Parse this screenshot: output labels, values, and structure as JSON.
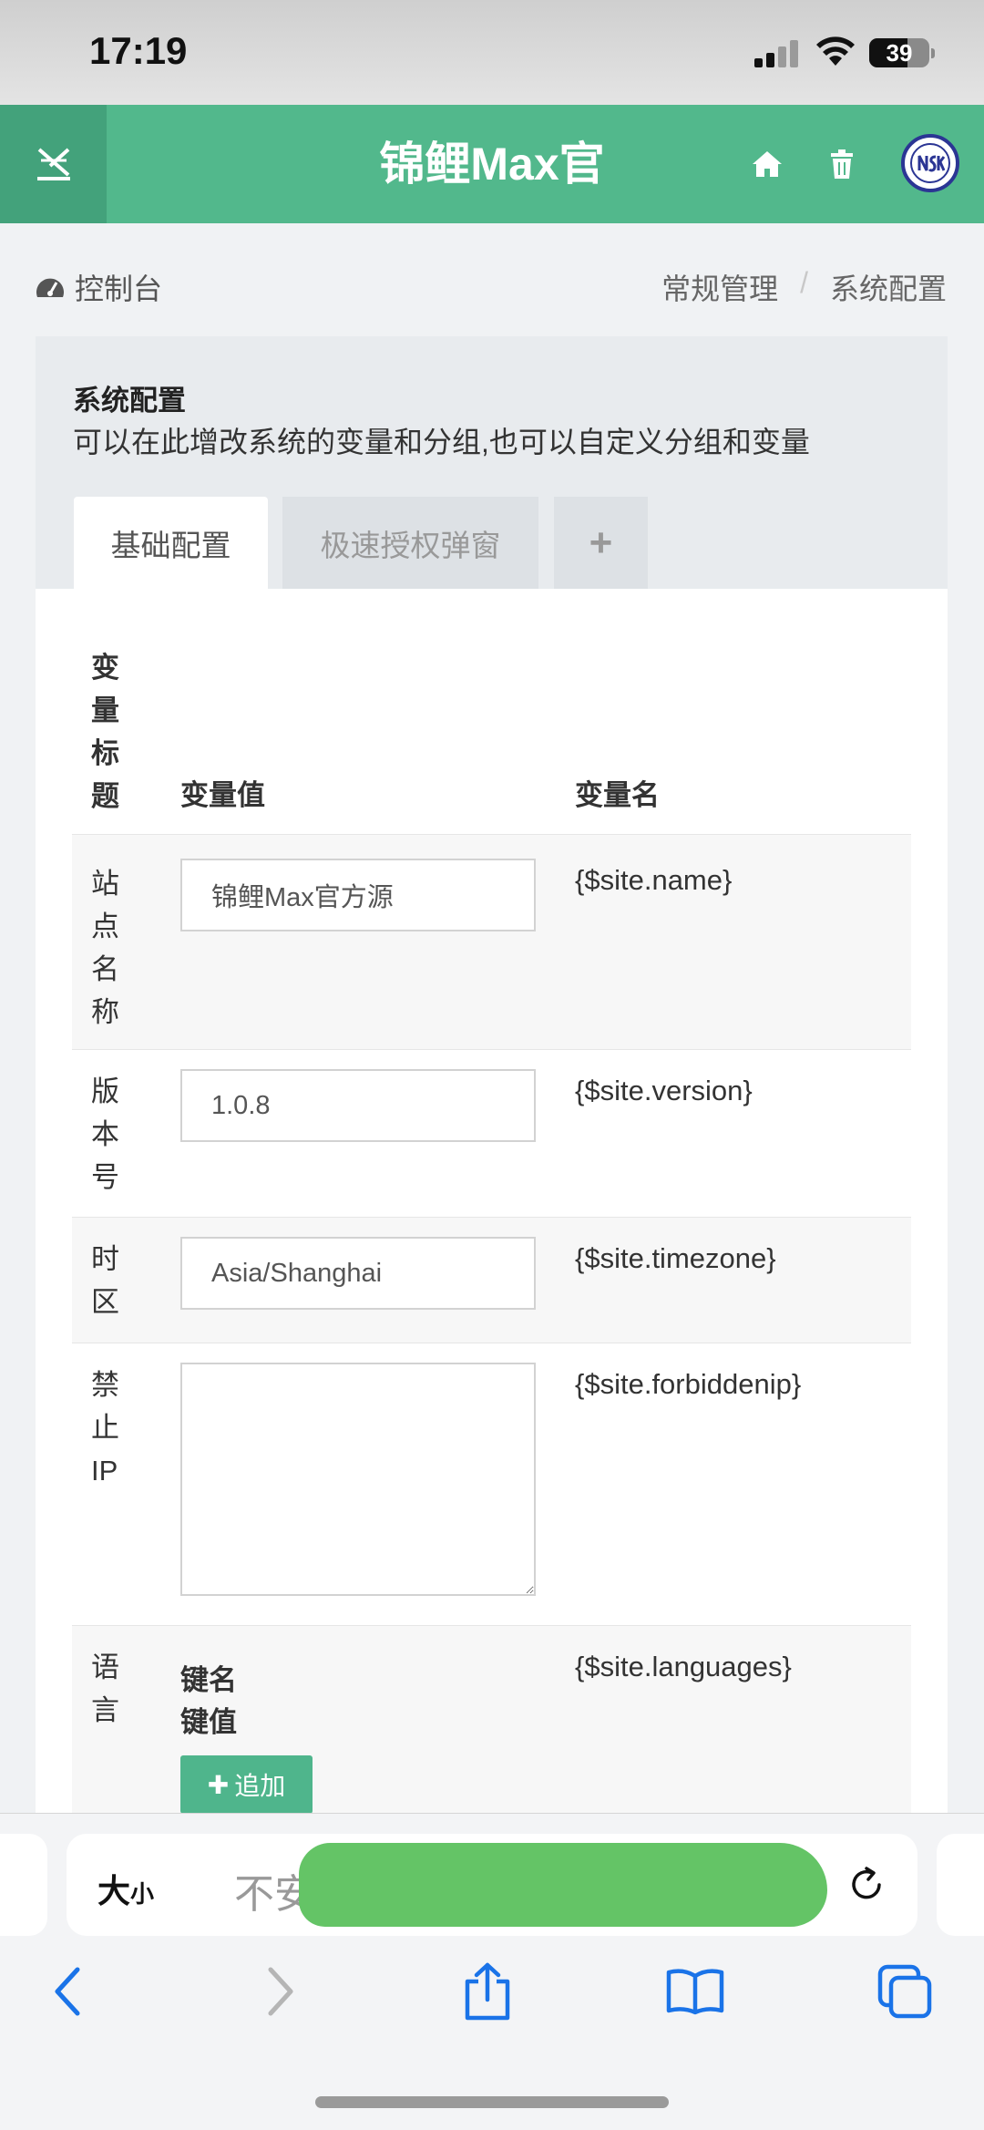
{
  "status_bar": {
    "time": "17:19",
    "battery": "39"
  },
  "header": {
    "title": "锦鲤Max官"
  },
  "breadcrumb": {
    "dashboard": "控制台",
    "items": [
      "常规管理",
      "系统配置"
    ],
    "separator": "/"
  },
  "panel": {
    "title": "系统配置",
    "description": "可以在此增改系统的变量和分组,也可以自定义分组和变量",
    "tabs": [
      {
        "label": "基础配置",
        "active": true
      },
      {
        "label": "极速授权弹窗",
        "active": false
      },
      {
        "label": "+",
        "active": false
      }
    ]
  },
  "table": {
    "headers": {
      "title": "变量标题",
      "value": "变量值",
      "name": "变量名"
    },
    "rows": [
      {
        "label": "站点名称",
        "value": "锦鲤Max官方源",
        "var": "{$site.name}"
      },
      {
        "label": "版本号",
        "value": "1.0.8",
        "var": "{$site.version}"
      },
      {
        "label": "时区",
        "value": "Asia/Shanghai",
        "var": "{$site.timezone}"
      },
      {
        "label": "禁止IP",
        "value": "",
        "var": "{$site.forbiddenip}"
      },
      {
        "label": "语言",
        "key_label": "键名",
        "value_label": "键值",
        "add_label": "追加",
        "var": "{$site.languages}"
      }
    ]
  },
  "browser": {
    "text_size_label": "大",
    "text_size_small": "小",
    "url_visible": "不安"
  },
  "colors": {
    "accent": "#52b88c",
    "accent_dark": "#43a27b",
    "avatar_ring": "#2b3594",
    "ios_blue": "#1a73e8"
  }
}
